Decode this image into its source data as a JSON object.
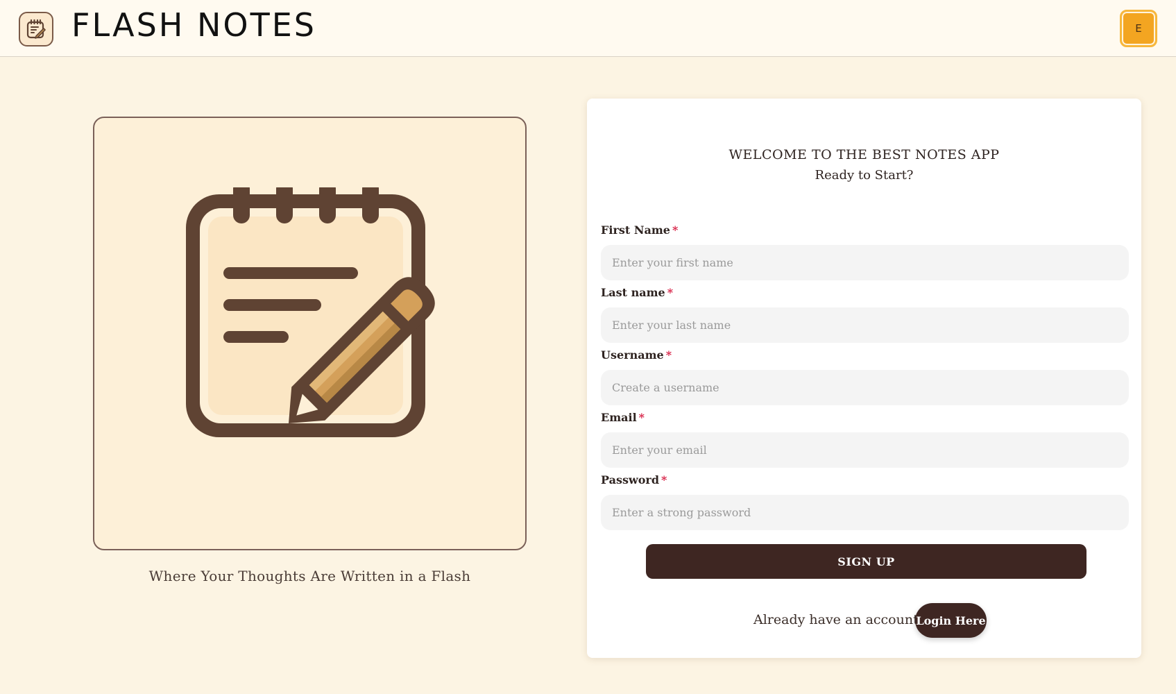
{
  "header": {
    "app_title": "FLASH NOTES",
    "avatar_initial": "E"
  },
  "hero": {
    "tagline": "Where Your Thoughts Are Written in a Flash",
    "icon": "notepad-pencil-icon"
  },
  "form": {
    "welcome": "WELCOME TO THE BEST NOTES APP",
    "subtitle": "Ready to Start?",
    "required_marker": "*",
    "fields": [
      {
        "label": "First Name",
        "placeholder": "Enter your first name",
        "value": ""
      },
      {
        "label": "Last name",
        "placeholder": "Enter your last name",
        "value": ""
      },
      {
        "label": "Username",
        "placeholder": "Create a username",
        "value": ""
      },
      {
        "label": "Email",
        "placeholder": "Enter your email",
        "value": ""
      },
      {
        "label": "Password",
        "placeholder": "Enter a strong password",
        "value": ""
      }
    ],
    "signup_label": "SIGN UP",
    "already_text": "Already have an account?",
    "login_label": "Login Here"
  },
  "colors": {
    "background": "#fcf4e3",
    "header_bg": "#fffaf0",
    "primary_button": "#3e2622",
    "avatar_bg": "#f3a521",
    "required": "#d8264a",
    "icon_brown": "#5f4333",
    "pencil": "#d4a05a"
  }
}
